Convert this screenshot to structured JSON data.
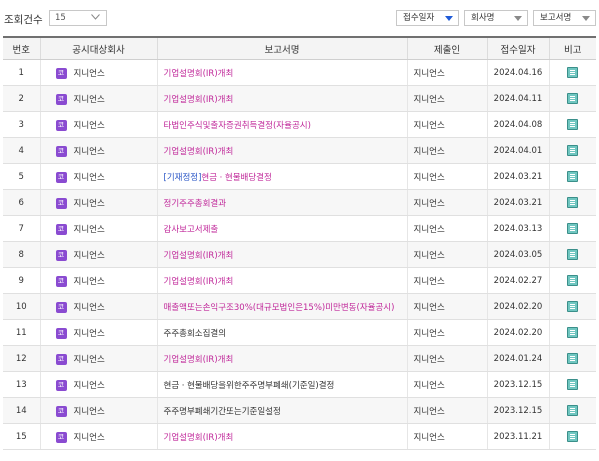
{
  "controls": {
    "count_label": "조회건수",
    "count_value": "15",
    "sort_options": [
      {
        "label": "접수일자",
        "active": true
      },
      {
        "label": "회사명",
        "active": false
      },
      {
        "label": "보고서명",
        "active": false
      }
    ]
  },
  "table": {
    "headers": [
      "번호",
      "공시대상회사",
      "보고서명",
      "제출인",
      "접수일자",
      "비고"
    ],
    "company_badge": "코",
    "colors": {
      "link_pink": "#c0289a",
      "link_blue": "#2a56c6",
      "text_dark": "#333333",
      "badge": "#8a4bd1",
      "note_icon": "#6fc6c0"
    },
    "rows": [
      {
        "num": "1",
        "company": "지니언스",
        "title": "기업설명회(IR)개최",
        "title_color": "pink",
        "submitter": "지니언스",
        "date": "2024.04.16"
      },
      {
        "num": "2",
        "company": "지니언스",
        "title": "기업설명회(IR)개최",
        "title_color": "pink",
        "submitter": "지니언스",
        "date": "2024.04.11"
      },
      {
        "num": "3",
        "company": "지니언스",
        "title": "타법인주식및출자증권취득결정(자율공시)",
        "title_color": "pink",
        "submitter": "지니언스",
        "date": "2024.04.08"
      },
      {
        "num": "4",
        "company": "지니언스",
        "title": "기업설명회(IR)개최",
        "title_color": "pink",
        "submitter": "지니언스",
        "date": "2024.04.01"
      },
      {
        "num": "5",
        "company": "지니언스",
        "title_prefix": "[기재정정]",
        "title": "현금ㆍ현물배당결정",
        "title_color": "pink",
        "submitter": "지니언스",
        "date": "2024.03.21"
      },
      {
        "num": "6",
        "company": "지니언스",
        "title": "정기주주총회결과",
        "title_color": "pink",
        "submitter": "지니언스",
        "date": "2024.03.21"
      },
      {
        "num": "7",
        "company": "지니언스",
        "title": "감사보고서제출",
        "title_color": "pink",
        "submitter": "지니언스",
        "date": "2024.03.13"
      },
      {
        "num": "8",
        "company": "지니언스",
        "title": "기업설명회(IR)개최",
        "title_color": "pink",
        "submitter": "지니언스",
        "date": "2024.03.05"
      },
      {
        "num": "9",
        "company": "지니언스",
        "title": "기업설명회(IR)개최",
        "title_color": "pink",
        "submitter": "지니언스",
        "date": "2024.02.27"
      },
      {
        "num": "10",
        "company": "지니언스",
        "title": "매출액또는손익구조30%(대규모법인은15%)미만변동(자율공시)",
        "title_color": "pink",
        "submitter": "지니언스",
        "date": "2024.02.20"
      },
      {
        "num": "11",
        "company": "지니언스",
        "title": "주주총회소집결의",
        "title_color": "dark",
        "submitter": "지니언스",
        "date": "2024.02.20"
      },
      {
        "num": "12",
        "company": "지니언스",
        "title": "기업설명회(IR)개최",
        "title_color": "pink",
        "submitter": "지니언스",
        "date": "2024.01.24"
      },
      {
        "num": "13",
        "company": "지니언스",
        "title": "현금ㆍ현물배당을위한주주명부폐쇄(기준일)결정",
        "title_color": "dark",
        "submitter": "지니언스",
        "date": "2023.12.15"
      },
      {
        "num": "14",
        "company": "지니언스",
        "title": "주주명부폐쇄기간또는기준일설정",
        "title_color": "dark",
        "submitter": "지니언스",
        "date": "2023.12.15"
      },
      {
        "num": "15",
        "company": "지니언스",
        "title": "기업설명회(IR)개최",
        "title_color": "pink",
        "submitter": "지니언스",
        "date": "2023.11.21"
      }
    ]
  }
}
